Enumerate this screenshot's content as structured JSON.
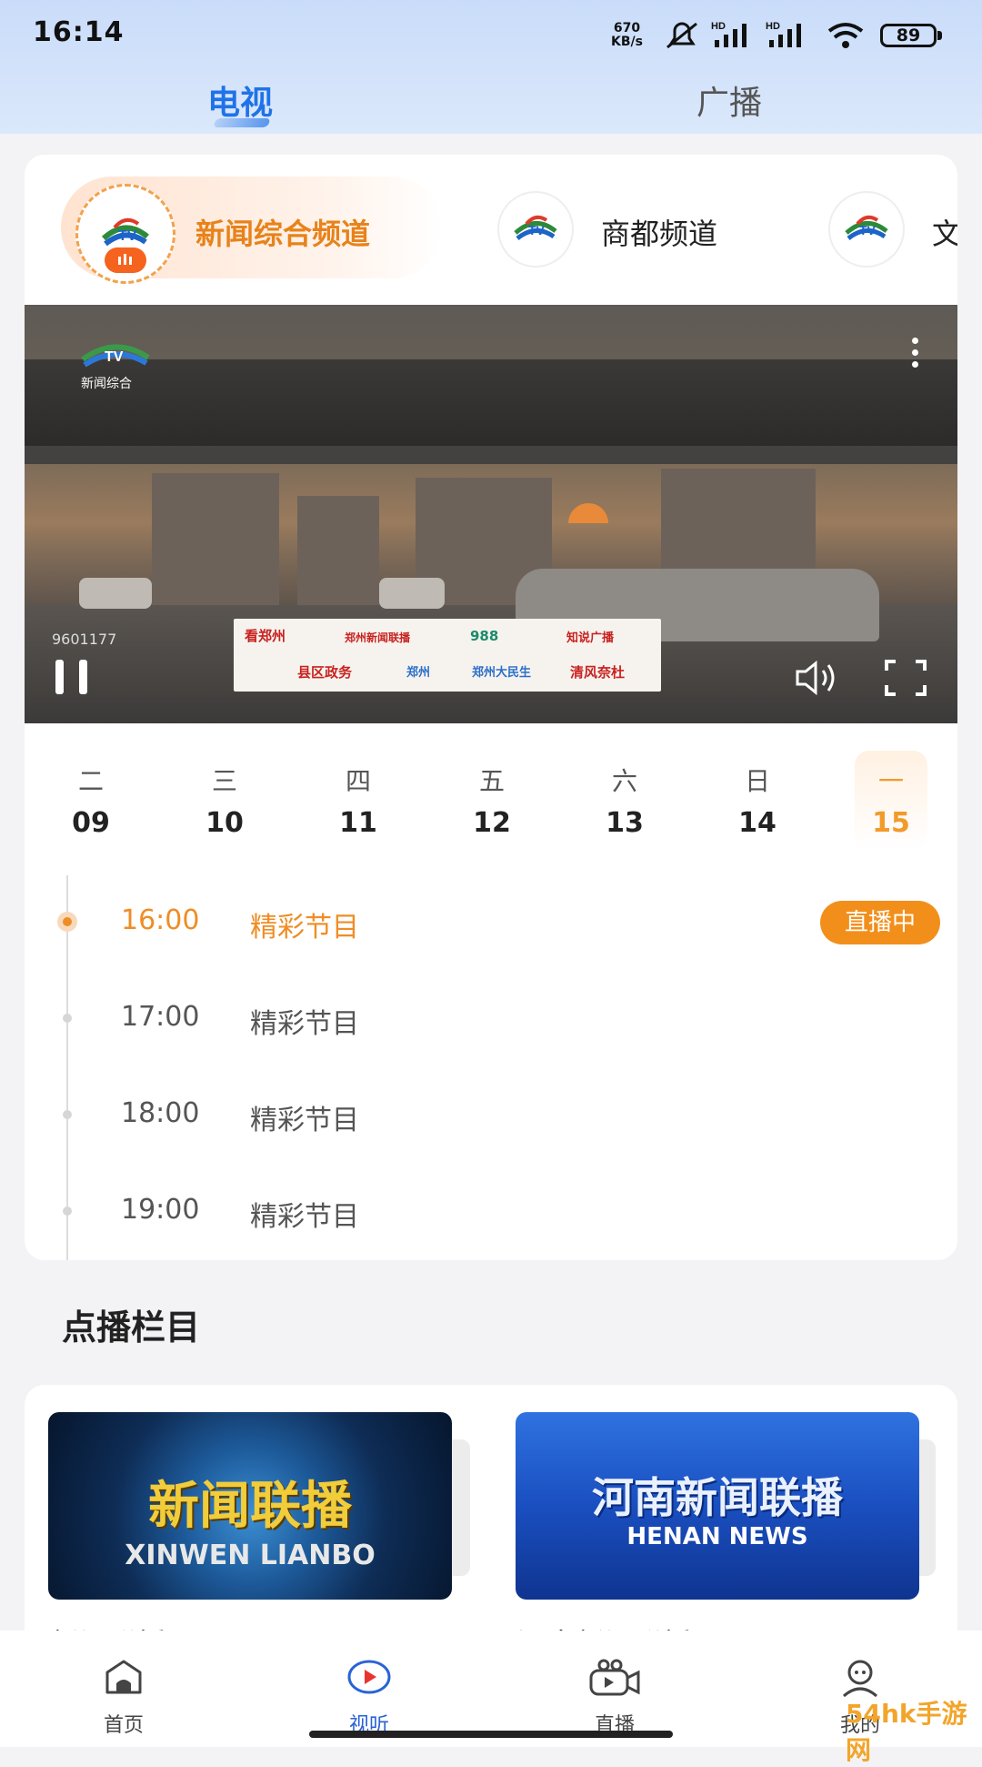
{
  "status_bar": {
    "time": "16:14",
    "net_speed_value": "670",
    "net_speed_unit": "KB/s",
    "battery": "89"
  },
  "top_tabs": [
    {
      "label": "电视"
    },
    {
      "label": "广播"
    }
  ],
  "channels": [
    {
      "label": "新闻综合频道"
    },
    {
      "label": "商都频道"
    },
    {
      "label": "文"
    }
  ],
  "player": {
    "logo_text": "新闻综合",
    "video_id": "9601177",
    "banner": [
      "看郑州",
      "郑州新闻联播",
      "988",
      "知说广播",
      "县区政务",
      "郑州",
      "郑州大民生",
      "清风奈杜"
    ]
  },
  "dates": [
    {
      "weekday": "二",
      "day": "09"
    },
    {
      "weekday": "三",
      "day": "10"
    },
    {
      "weekday": "四",
      "day": "11"
    },
    {
      "weekday": "五",
      "day": "12"
    },
    {
      "weekday": "六",
      "day": "13"
    },
    {
      "weekday": "日",
      "day": "14"
    },
    {
      "weekday": "一",
      "day": "15"
    }
  ],
  "schedule": [
    {
      "time": "16:00",
      "title": "精彩节目",
      "badge": "直播中"
    },
    {
      "time": "17:00",
      "title": "精彩节目"
    },
    {
      "time": "18:00",
      "title": "精彩节目"
    },
    {
      "time": "19:00",
      "title": "精彩节目"
    }
  ],
  "vod": {
    "section_title": "点播栏目",
    "items": [
      {
        "thumb_cn": "新闻联播",
        "thumb_en": "XINWEN LIANBO",
        "label": "新闻联播"
      },
      {
        "thumb_cn": "河南新闻联播",
        "thumb_en": "HENAN NEWS",
        "label": "河南新闻联播"
      }
    ]
  },
  "bottom_nav": [
    {
      "label": "首页"
    },
    {
      "label": "视听"
    },
    {
      "label": "直播"
    },
    {
      "label": "我的"
    }
  ],
  "watermark": "54hk手游网",
  "colors": {
    "accent_blue": "#1f73e8",
    "accent_orange": "#ef8d25",
    "live_badge": "#f28f1b"
  }
}
